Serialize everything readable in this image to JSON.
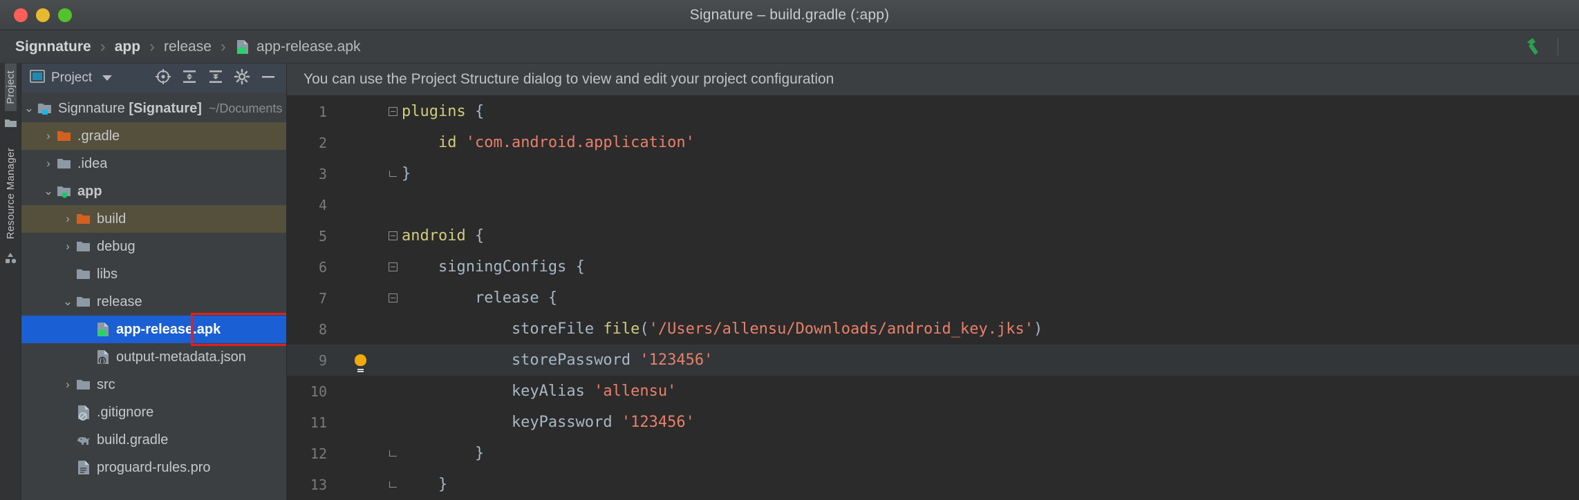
{
  "window": {
    "title": "Signature – build.gradle (:app)",
    "traffic_lights": [
      "close-red",
      "minimize-yellow",
      "zoom-green"
    ],
    "colors": {
      "red": "#ff5f57",
      "yellow": "#e6b92e",
      "green": "#53c22b"
    }
  },
  "breadcrumb": {
    "items": [
      {
        "label": "Signnature",
        "bold": true,
        "icon": null
      },
      {
        "label": "app",
        "bold": true,
        "icon": null
      },
      {
        "label": "release",
        "bold": false,
        "icon": null
      },
      {
        "label": "app-release.apk",
        "bold": false,
        "icon": "apk-icon"
      }
    ],
    "separator": "›",
    "build_icon": "hammer-icon"
  },
  "toolstrip": {
    "tabs": [
      {
        "label": "Project",
        "active": true
      },
      {
        "label": "Resource Manager",
        "active": false
      }
    ],
    "icons": [
      "folder-icon",
      "resource-manager-icon"
    ]
  },
  "project_panel": {
    "header": {
      "icon": "project-view-icon",
      "title": "Project",
      "dropdown_icon": "chevron-down-icon",
      "tools": [
        "locate-target-icon",
        "expand-all-icon",
        "collapse-all-icon",
        "settings-gear-icon",
        "hide-panel-icon"
      ]
    },
    "tree": [
      {
        "label": "Signnature",
        "suffix": "[Signature]",
        "path_hint": "~/Documents",
        "indent": 0,
        "arrow": "expanded",
        "icon": "module-folder-icon",
        "bold": false,
        "state": "normal"
      },
      {
        "label": ".gradle",
        "indent": 1,
        "arrow": "collapsed",
        "icon": "orange-folder-icon",
        "state": "highlight"
      },
      {
        "label": ".idea",
        "indent": 1,
        "arrow": "collapsed",
        "icon": "folder-icon",
        "state": "normal"
      },
      {
        "label": "app",
        "indent": 1,
        "arrow": "expanded",
        "icon": "module-folder-green-icon",
        "bold": true,
        "state": "normal"
      },
      {
        "label": "build",
        "indent": 2,
        "arrow": "collapsed",
        "icon": "orange-folder-icon",
        "state": "highlight"
      },
      {
        "label": "debug",
        "indent": 2,
        "arrow": "collapsed",
        "icon": "folder-icon",
        "state": "normal"
      },
      {
        "label": "libs",
        "indent": 2,
        "arrow": "none",
        "icon": "folder-icon",
        "state": "normal"
      },
      {
        "label": "release",
        "indent": 2,
        "arrow": "expanded",
        "icon": "folder-icon",
        "state": "normal"
      },
      {
        "label": "app-release.apk",
        "indent": 3,
        "arrow": "none",
        "icon": "apk-icon",
        "state": "selected"
      },
      {
        "label": "output-metadata.json",
        "indent": 3,
        "arrow": "none",
        "icon": "json-file-icon",
        "state": "normal"
      },
      {
        "label": "src",
        "indent": 2,
        "arrow": "collapsed",
        "icon": "folder-icon",
        "state": "normal"
      },
      {
        "label": ".gitignore",
        "indent": 2,
        "arrow": "none",
        "icon": "gitignore-file-icon",
        "state": "normal"
      },
      {
        "label": "build.gradle",
        "indent": 2,
        "arrow": "none",
        "icon": "gradle-elephant-icon",
        "state": "normal"
      },
      {
        "label": "proguard-rules.pro",
        "indent": 2,
        "arrow": "none",
        "icon": "text-file-icon",
        "state": "normal"
      }
    ],
    "selection_annotation_color": "#e02020"
  },
  "editor": {
    "notification": "You can use the Project Structure dialog to view and edit your project configuration",
    "filename": "build.gradle",
    "caret_line": 9,
    "intention_bulb_line": 9,
    "lines": [
      {
        "n": 1,
        "fold": "start",
        "indent": 0,
        "tokens": [
          {
            "t": "plugins",
            "c": "kw"
          },
          {
            "t": " ",
            "c": "punct"
          },
          {
            "t": "{",
            "c": "punct"
          }
        ]
      },
      {
        "n": 2,
        "fold": "none",
        "indent": 1,
        "tokens": [
          {
            "t": "    id ",
            "c": "kw"
          },
          {
            "t": "'com.android.application'",
            "c": "str"
          }
        ]
      },
      {
        "n": 3,
        "fold": "end",
        "indent": 0,
        "tokens": [
          {
            "t": "}",
            "c": "punct"
          }
        ]
      },
      {
        "n": 4,
        "fold": "none",
        "indent": 0,
        "tokens": []
      },
      {
        "n": 5,
        "fold": "start",
        "indent": 0,
        "tokens": [
          {
            "t": "android",
            "c": "kw"
          },
          {
            "t": " {",
            "c": "punct"
          }
        ]
      },
      {
        "n": 6,
        "fold": "start",
        "indent": 1,
        "tokens": [
          {
            "t": "    signingConfigs {",
            "c": "ident"
          }
        ]
      },
      {
        "n": 7,
        "fold": "start",
        "indent": 2,
        "tokens": [
          {
            "t": "        release {",
            "c": "ident"
          }
        ]
      },
      {
        "n": 8,
        "fold": "none",
        "indent": 3,
        "tokens": [
          {
            "t": "            storeFile ",
            "c": "ident"
          },
          {
            "t": "file",
            "c": "fn"
          },
          {
            "t": "(",
            "c": "paren"
          },
          {
            "t": "'/Users/allensu/Downloads/android_key.jks'",
            "c": "str"
          },
          {
            "t": ")",
            "c": "paren"
          }
        ]
      },
      {
        "n": 9,
        "fold": "none",
        "indent": 3,
        "tokens": [
          {
            "t": "            storePassword ",
            "c": "ident"
          },
          {
            "t": "'123456'",
            "c": "str"
          }
        ]
      },
      {
        "n": 10,
        "fold": "none",
        "indent": 3,
        "tokens": [
          {
            "t": "            keyAlias ",
            "c": "ident"
          },
          {
            "t": "'allensu'",
            "c": "str"
          }
        ]
      },
      {
        "n": 11,
        "fold": "none",
        "indent": 3,
        "tokens": [
          {
            "t": "            keyPassword ",
            "c": "ident"
          },
          {
            "t": "'123456'",
            "c": "str"
          }
        ]
      },
      {
        "n": 12,
        "fold": "end",
        "indent": 2,
        "tokens": [
          {
            "t": "        }",
            "c": "punct"
          }
        ]
      },
      {
        "n": 13,
        "fold": "end",
        "indent": 1,
        "tokens": [
          {
            "t": "    }",
            "c": "punct"
          }
        ]
      }
    ],
    "colors": {
      "background": "#2b2b2b",
      "caret_line": "#323639",
      "keyword": "#cfcc7d",
      "string": "#e8806a",
      "identifier": "#a9b7c6",
      "line_number": "#787b7d"
    }
  }
}
